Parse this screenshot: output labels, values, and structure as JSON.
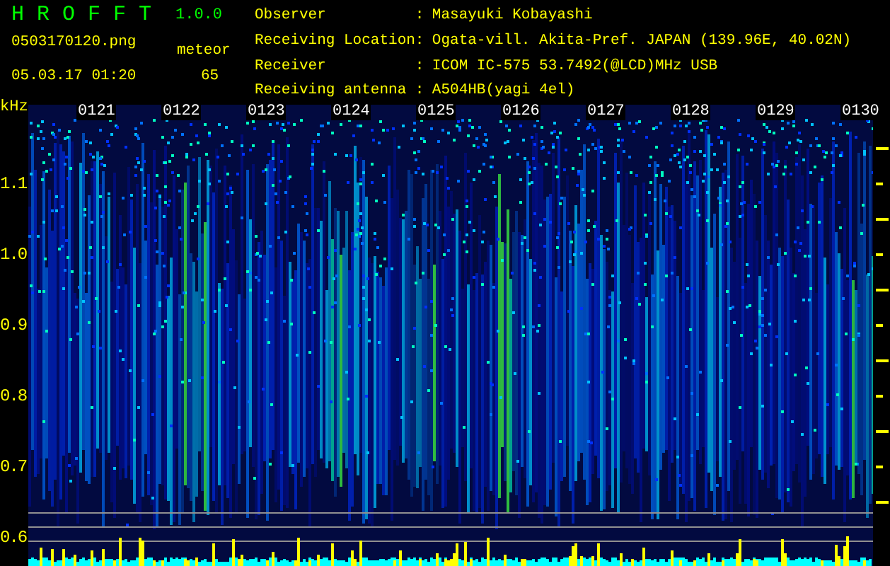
{
  "app": {
    "name": "H R O F F T",
    "version": "1.0.0"
  },
  "file": {
    "filename": "0503170120.png",
    "datetime": "05.03.17 01:20",
    "count_label": "meteor",
    "count": "65"
  },
  "station": [
    {
      "label": "Observer",
      "separator": ":",
      "value": "Masayuki Kobayashi"
    },
    {
      "label": "Receiving Location",
      "separator": ":",
      "value": "Ogata-vill. Akita-Pref. JAPAN (139.96E, 40.02N)"
    },
    {
      "label": "Receiver",
      "separator": ":",
      "value": "ICOM IC-575 53.7492(@LCD)MHz USB"
    },
    {
      "label": "Receiving antenna",
      "separator": ":",
      "value": "A504HB(yagi 4el)"
    }
  ],
  "plot": {
    "y_unit": "kHz",
    "y_labels": [
      "1.1",
      "1.0",
      "0.9",
      "0.8",
      "0.7",
      "0.6"
    ],
    "time_labels": [
      "0121",
      "0122",
      "0123",
      "0124",
      "0125",
      "0126",
      "0127",
      "0128",
      "0129",
      "0130"
    ]
  }
}
